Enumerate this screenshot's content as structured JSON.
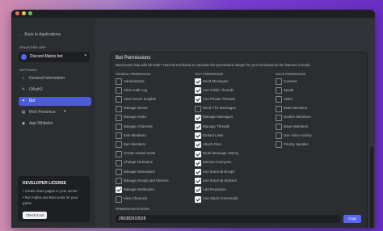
{
  "window": {
    "controls": [
      {
        "name": "close",
        "color": "#ed6a5e"
      },
      {
        "name": "minimize",
        "color": "#f5bf4f"
      },
      {
        "name": "maximize",
        "color": "#61c554"
      }
    ]
  },
  "sidebar": {
    "back_label": "← Back to Applications",
    "selected_app_heading": "SELECTED APP",
    "selected_app_name": "Discord-Matrix bot",
    "settings_heading": "SETTINGS",
    "nav_items": [
      {
        "label": "General Information",
        "icon": "home-icon",
        "glyph": "⌂",
        "active": false
      },
      {
        "label": "OAuth2",
        "icon": "wrench-icon",
        "glyph": "✎",
        "active": false
      },
      {
        "label": "Bot",
        "icon": "puzzle-icon",
        "glyph": "✦",
        "active": true
      },
      {
        "label": "Rich Presence",
        "icon": "document-icon",
        "glyph": "▤",
        "active": false,
        "has_chevron": true
      },
      {
        "label": "App Whitelist",
        "icon": "controller-icon",
        "glyph": "◉",
        "active": false
      }
    ],
    "developer_license": {
      "title": "DEVELOPER LICENSE",
      "bullets": [
        "• Create store pages in your server",
        "• Run Alpha and Beta tests for your",
        "  game"
      ],
      "button_label": "Check it out"
    }
  },
  "panel": {
    "title": "Bot Permissions",
    "description_before_link": "Need some help with bit math? Use this tool below to calculate the permissions integer for your bot based on the features it needs.",
    "columns": [
      {
        "heading": "GENERAL PERMISSIONS",
        "items": [
          {
            "label": "Administrator",
            "checked": false
          },
          {
            "label": "View Audit Log",
            "checked": false
          },
          {
            "label": "View Server Insights",
            "checked": false
          },
          {
            "label": "Manage Server",
            "checked": false
          },
          {
            "label": "Manage Roles",
            "checked": false
          },
          {
            "label": "Manage Channels",
            "checked": false
          },
          {
            "label": "Kick Members",
            "checked": false
          },
          {
            "label": "Ban Members",
            "checked": false
          },
          {
            "label": "Create Instant Invite",
            "checked": false
          },
          {
            "label": "Change Nickname",
            "checked": false
          },
          {
            "label": "Manage Nicknames",
            "checked": false
          },
          {
            "label": "Manage Emojis and Stickers",
            "checked": false
          },
          {
            "label": "Manage Webhooks",
            "checked": true
          },
          {
            "label": "View Channels",
            "checked": false
          }
        ]
      },
      {
        "heading": "TEXT PERMISSIONS",
        "items": [
          {
            "label": "Send Messages",
            "checked": true
          },
          {
            "label": "Use Public Threads",
            "checked": true
          },
          {
            "label": "Use Private Threads",
            "checked": true
          },
          {
            "label": "Send TTS Messages",
            "checked": false
          },
          {
            "label": "Manage Messages",
            "checked": true
          },
          {
            "label": "Manage Threads",
            "checked": true
          },
          {
            "label": "Embed Links",
            "checked": true
          },
          {
            "label": "Attach Files",
            "checked": true
          },
          {
            "label": "Read Message History",
            "checked": true
          },
          {
            "label": "Mention Everyone",
            "checked": true
          },
          {
            "label": "Use External Emojis",
            "checked": true
          },
          {
            "label": "Use External Stickers",
            "checked": true
          },
          {
            "label": "Add Reactions",
            "checked": true
          },
          {
            "label": "Use Slash Commands",
            "checked": true
          }
        ]
      },
      {
        "heading": "VOICE PERMISSIONS",
        "items": [
          {
            "label": "Connect",
            "checked": false
          },
          {
            "label": "Speak",
            "checked": false
          },
          {
            "label": "Video",
            "checked": false
          },
          {
            "label": "Mute Members",
            "checked": false
          },
          {
            "label": "Deafen Members",
            "checked": false
          },
          {
            "label": "Move Members",
            "checked": false
          },
          {
            "label": "Use Voice Activity",
            "checked": false
          },
          {
            "label": "Priority Speaker",
            "checked": false
          }
        ]
      }
    ],
    "integer_label": "PERMISSIONS INTEGER",
    "integer_value": "260382910528",
    "copy_label": "Copy"
  }
}
